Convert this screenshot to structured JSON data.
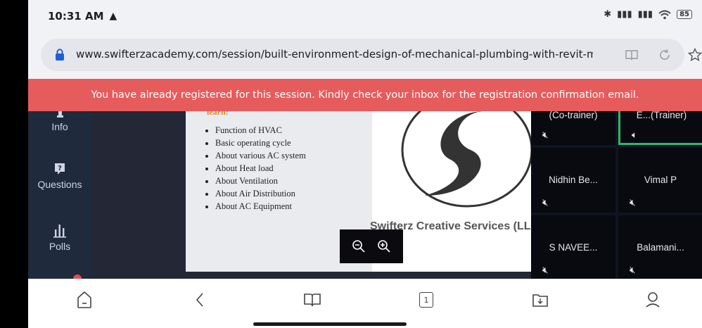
{
  "status": {
    "time": "10:31 AM",
    "warning_glyph": "▲",
    "battery": "85"
  },
  "browser": {
    "url": "www.swifterzacademy.com/session/built-environment-design-of-mechanical-plumbing-with-revit-mep--"
  },
  "banner": {
    "text": "You have already registered for this session. Kindly check your inbox for the registration confirmation email."
  },
  "sidenav": {
    "items": [
      {
        "label": "Info",
        "icon": "info-icon"
      },
      {
        "label": "Questions",
        "icon": "question-icon"
      },
      {
        "label": "Polls",
        "icon": "polls-icon"
      }
    ]
  },
  "slide": {
    "bullets": [
      "Function of HVAC",
      "Basic operating cycle",
      "About various AC system",
      "About Heat load",
      "About Ventilation",
      "About Air Distribution",
      "About AC Equipment"
    ],
    "company": "Swifterz Creative Services (LLP)"
  },
  "participants": [
    {
      "name": "(Co-trainer)",
      "muted": true
    },
    {
      "name": "E...(Trainer)",
      "muted": false
    },
    {
      "name": "Nidhin Be...",
      "muted": true
    },
    {
      "name": "Vimal P",
      "muted": true
    },
    {
      "name": "S NAVEE...",
      "muted": true
    },
    {
      "name": "Balamani...",
      "muted": true
    }
  ],
  "bottom_nav": {
    "tab_count": "1"
  },
  "colors": {
    "banner": "#e65b5c",
    "sidebar": "#1f2a3c",
    "accent": "#2fb56b"
  }
}
